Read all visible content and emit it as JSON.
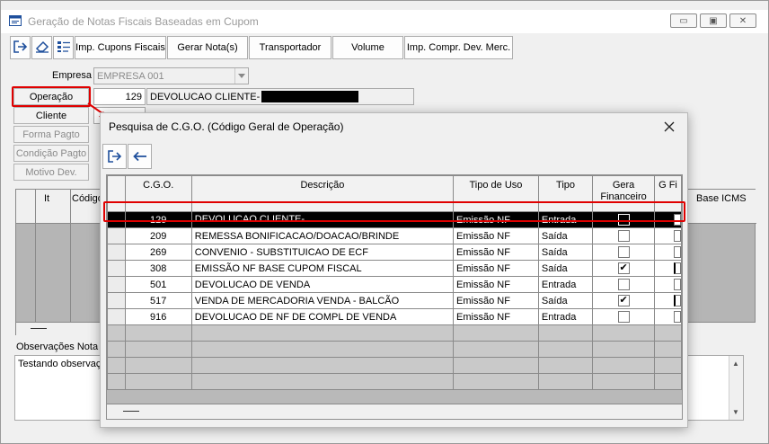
{
  "main": {
    "title": "Geração de Notas Fiscais Baseadas em Cupom",
    "toolbar": [
      "Imp. Cupons Fiscais",
      "Gerar Nota(s)",
      "Transportador",
      "Volume",
      "Imp. Compr. Dev. Merc."
    ],
    "empresa_label": "Empresa",
    "empresa_value": "EMPRESA 001",
    "operacao_label": "Operação",
    "operacao_code": "129",
    "operacao_desc": "DEVOLUCAO CLIENTE-",
    "cliente_label": "Cliente",
    "forma_pagto_label": "Forma Pagto",
    "condicao_pagto_label": "Condição Pagto",
    "motivo_dev_label": "Motivo Dev.",
    "grid_headers": {
      "it": "It",
      "codigo": "Código",
      "base_icms": "Base ICMS"
    },
    "obs_label": "Observações Nota F",
    "obs_value": "Testando observaç"
  },
  "dialog": {
    "title": "Pesquisa de C.G.O. (Código Geral de Operação)",
    "columns": [
      "C.G.O.",
      "Descrição",
      "Tipo de Uso",
      "Tipo",
      "Gera Financeiro",
      "G Fi"
    ],
    "rows": [
      {
        "cgo": "129",
        "descricao": "DEVOLUCAO CLIENTE-",
        "uso": "Emissão NF",
        "tipo": "Entrada",
        "gera": false,
        "selected": true
      },
      {
        "cgo": "209",
        "descricao": "REMESSA BONIFICACAO/DOACAO/BRINDE",
        "uso": "Emissão NF",
        "tipo": "Saída",
        "gera": false,
        "selected": false
      },
      {
        "cgo": "269",
        "descricao": "CONVENIO - SUBSTITUICAO DE ECF",
        "uso": "Emissão NF",
        "tipo": "Saída",
        "gera": false,
        "selected": false
      },
      {
        "cgo": "308",
        "descricao": "EMISSÃO NF BASE CUPOM FISCAL",
        "uso": "Emissão NF",
        "tipo": "Saída",
        "gera": true,
        "selected": false
      },
      {
        "cgo": "501",
        "descricao": "DEVOLUCAO DE VENDA",
        "uso": "Emissão NF",
        "tipo": "Entrada",
        "gera": false,
        "selected": false
      },
      {
        "cgo": "517",
        "descricao": "VENDA DE MERCADORIA VENDA - BALCÃO",
        "uso": "Emissão NF",
        "tipo": "Saída",
        "gera": true,
        "selected": false
      },
      {
        "cgo": "916",
        "descricao": "DEVOLUCAO DE NF DE COMPL DE VENDA",
        "uso": "Emissão NF",
        "tipo": "Entrada",
        "gera": false,
        "selected": false
      }
    ]
  },
  "icons": {
    "exit": "exit-icon",
    "eraser": "eraser-icon",
    "list": "list-icon",
    "back": "arrow-left-icon",
    "close": "close-icon"
  },
  "colors": {
    "accent": "#1e4f9c",
    "highlight": "#e00000",
    "selection": "#000000"
  }
}
